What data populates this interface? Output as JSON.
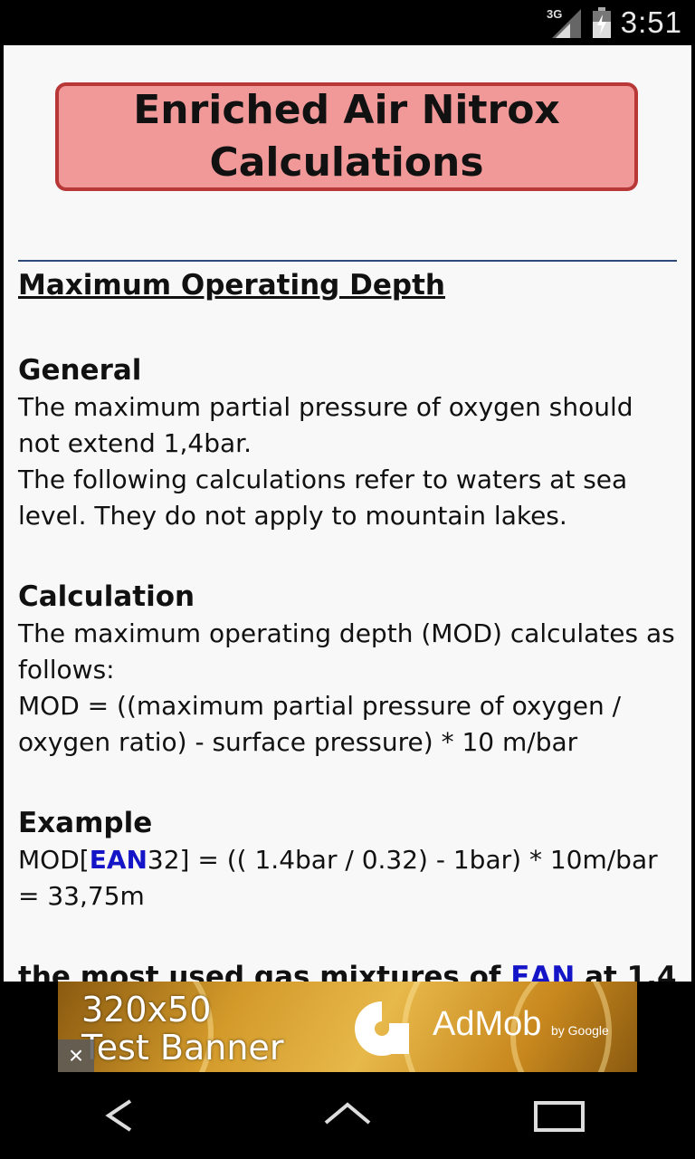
{
  "status_bar": {
    "network": "3G",
    "time": "3:51"
  },
  "header": {
    "title": "Enriched Air Nitrox Calculations"
  },
  "article": {
    "main_heading": "Maximum Operating Depth",
    "sections": {
      "general": {
        "heading": "General",
        "p1": "The maximum partial pressure of oxygen should not extend 1,4bar.",
        "p2": "The following calculations refer to waters at sea level. They do not apply to mountain lakes."
      },
      "calculation": {
        "heading": "Calculation",
        "p1": "The maximum operating depth (MOD) calculates as follows:",
        "p2": "MOD = ((maximum partial pressure of oxygen / oxygen ratio) - surface pressure) * 10 m/bar"
      },
      "example": {
        "heading": "Example",
        "prefix": "MOD[",
        "link": "EAN",
        "suffix": "32] = (( 1.4bar / 0.32) - 1bar) * 10m/bar = 33,75m"
      },
      "next_heading": {
        "prefix": "the most used gas mixtures of ",
        "link": "EAN",
        "suffix": " at 1,4"
      }
    }
  },
  "ad_banner": {
    "text_line1": "320x50",
    "text_line2": "Test Banner",
    "brand": "AdMob",
    "brand_sub": "by Google",
    "close_label": "×"
  },
  "navigation_bar": {
    "icons": [
      "back-icon",
      "home-icon",
      "recents-icon"
    ]
  },
  "colors": {
    "title_fill": "#f19999",
    "title_border": "#b83838",
    "link": "#1515c8",
    "divider": "#2d4a7a"
  }
}
